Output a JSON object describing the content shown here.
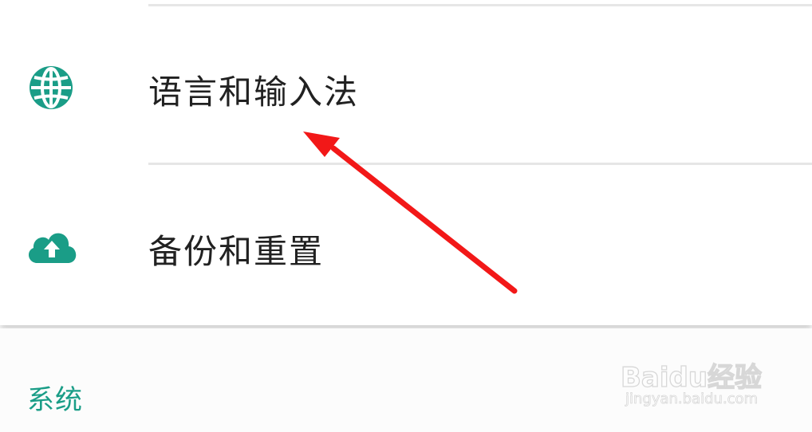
{
  "settings": {
    "items": [
      {
        "label": "语言和输入法",
        "icon": "globe-icon"
      },
      {
        "label": "备份和重置",
        "icon": "cloud-upload-icon"
      }
    ],
    "section_header": "系统"
  },
  "watermark": {
    "brand": "Baidu经验",
    "site": "jingyan.baidu.com"
  },
  "colors": {
    "accent": "#1a9d87",
    "text": "#212121",
    "arrow": "#f21818",
    "divider": "#e6e6e6"
  }
}
